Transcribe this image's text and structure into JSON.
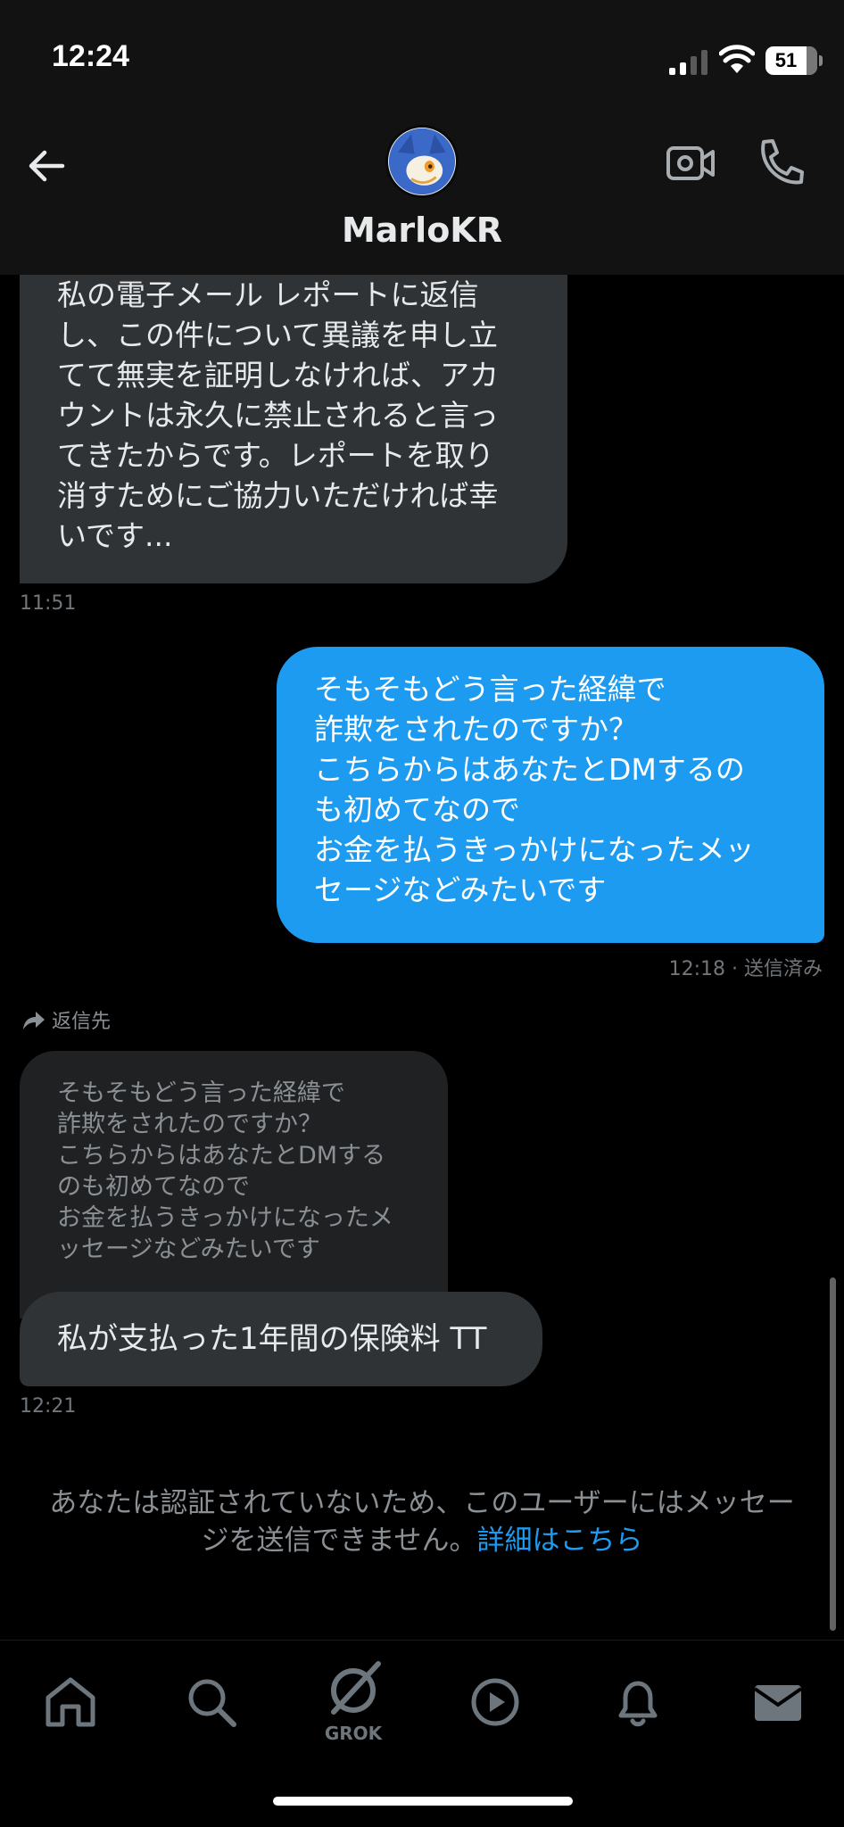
{
  "status_bar": {
    "time": "12:24",
    "battery_level": "51"
  },
  "header": {
    "contact_name": "MarloKR"
  },
  "messages": [
    {
      "direction": "incoming",
      "text": "私の電子メール レポートに返信\nし、この件について異議を申し立\nてて無実を証明しなければ、アカ\nウントは永久に禁止されると言っ\nてきたからです。レポートを取り\n消すためにご協力いただければ幸\nいです...",
      "timestamp": "11:51"
    },
    {
      "direction": "outgoing",
      "text": "そもそもどう言った経緯で\n詐欺をされたのですか？\nこちらからはあなたとDMするの\nも初めてなので\nお金を払うきっかけになったメッ\nセージなどみたいです",
      "timestamp": "12:18 · 送信済み"
    },
    {
      "direction": "incoming",
      "reply_label": "返信先",
      "quoted_text": "そもそもどう言った経緯で\n詐欺をされたのですか？\nこちらからはあなたとDMする\nのも初めてなので\nお金を払うきっかけになったメ\nッセージなどみたいです",
      "text": "私が支払った1年間の保険料 TT",
      "timestamp": "12:21"
    }
  ],
  "notice": {
    "text": "あなたは認証されていないため、このユーザーにはメッセー\nジを送信できません。",
    "link": "詳細はこちら"
  },
  "tab_bar": {
    "items": [
      "home-icon",
      "search-icon",
      "grok-icon",
      "video-icon",
      "notifications-icon",
      "messages-icon"
    ],
    "grok_label": "GROK"
  },
  "colors": {
    "accent": "#1d9bf0",
    "incoming_bubble": "#2f3336",
    "background": "#000000"
  }
}
